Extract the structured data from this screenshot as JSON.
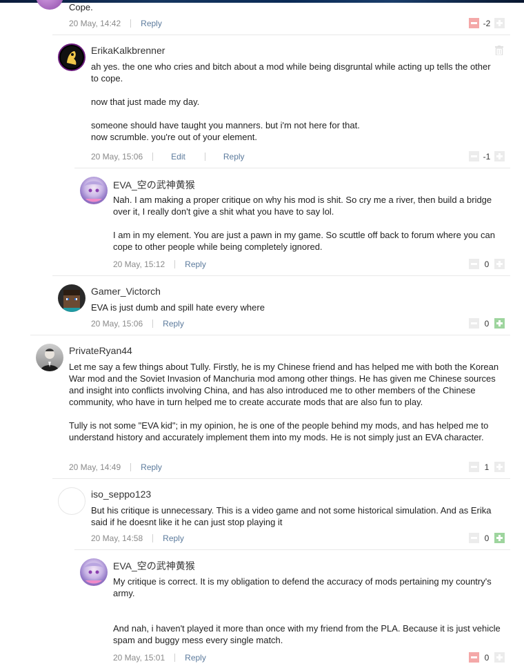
{
  "comments": [
    {
      "body_tail": "Cope.",
      "time": "20 May, 14:42",
      "reply": "Reply",
      "score": "-2"
    },
    {
      "username": "ErikaKalkbrenner",
      "body": "ah yes. the one who cries and bitch about a mod while being disgruntal while acting up tells the other to cope.\n\nnow that just made my day.\n\nsomeone should have taught you manners. but i'm not here for that.\nnow scrumble. you're out of your element.",
      "time": "20 May, 15:06",
      "edit": "Edit",
      "reply": "Reply",
      "score": "-1"
    },
    {
      "username": "EVA_空の武神黄猴",
      "body": "Nah. I am making a proper critique on why his mod is shit. So cry me a river, then build a bridge over it, I really don't give a shit what you have to say lol.\n\nI am in my element. You are just a pawn in my game. So scuttle off back to forum where you can cope to other people while being completely ignored.",
      "time": "20 May, 15:12",
      "reply": "Reply",
      "score": "0"
    },
    {
      "username": "Gamer_Victorch",
      "body": "EVA is just dumb and spill hate every where",
      "time": "20 May, 15:06",
      "reply": "Reply",
      "score": "0"
    },
    {
      "username": "PrivateRyan44",
      "body": "Let me say a few things about Tully. Firstly, he is my Chinese friend and has helped me with both the Korean War mod and the Soviet Invasion of Manchuria mod among other things. He has given me Chinese sources and insight into conflicts involving China, and has also introduced me to other members of the Chinese community, who have in turn helped me to create accurate mods that are also fun to play.\n\nTully is not some \"EVA kid\"; in my opinion, he is one of the people behind my mods, and has helped me to understand history and accurately implement them into my mods. He is not simply just an EVA character.",
      "time": "20 May, 14:49",
      "reply": "Reply",
      "score": "1"
    },
    {
      "username": "iso_seppo123",
      "body": "But his critique is unnecessary. This is a video game and not some historical simulation. And as Erika said if he doesnt like it he can just stop playing it",
      "time": "20 May, 14:58",
      "reply": "Reply",
      "score": "0"
    },
    {
      "username": "EVA_空の武神黄猴",
      "body": "My critique is correct. It is my obligation to defend the accuracy of mods pertaining my country's army.\n\n\nAnd nah, i haven't played it more than once with my friend from the PLA. Because it is just vehicle spam and buggy mess every single match.",
      "time": "20 May, 15:01",
      "reply": "Reply",
      "score": "0"
    }
  ],
  "icons": {
    "downvote": "minus-icon",
    "upvote": "plus-icon",
    "delete": "trash-icon"
  },
  "colors": {
    "link": "#5b7a9c",
    "downvote_active": "#f4a8a8",
    "upvote_active": "#9ed59e"
  }
}
